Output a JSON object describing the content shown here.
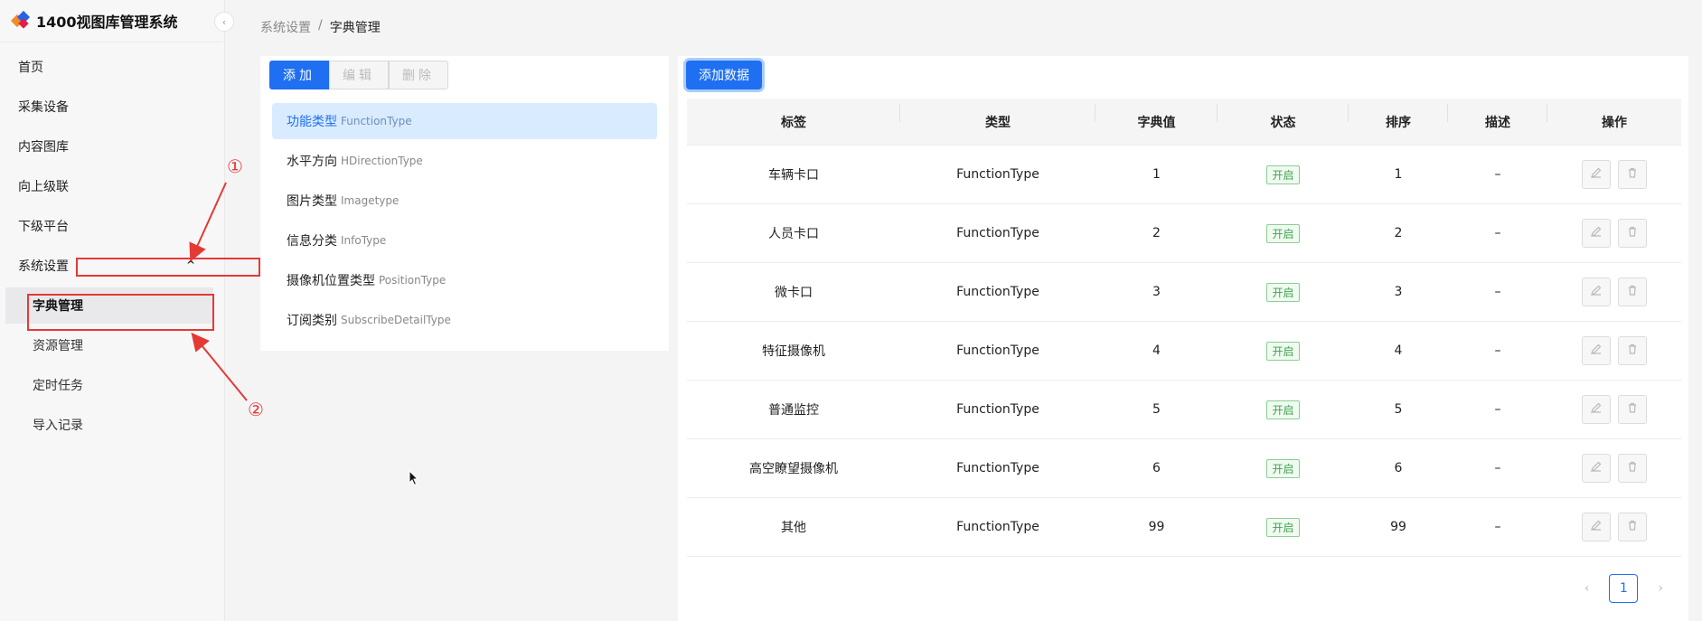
{
  "app": {
    "title": "1400视图库管理系统"
  },
  "sidebar": {
    "items": [
      {
        "label": "首页"
      },
      {
        "label": "采集设备"
      },
      {
        "label": "内容图库"
      },
      {
        "label": "向上级联"
      },
      {
        "label": "下级平台"
      },
      {
        "label": "系统设置"
      }
    ],
    "submenu": [
      {
        "label": "字典管理"
      },
      {
        "label": "资源管理"
      },
      {
        "label": "定时任务"
      },
      {
        "label": "导入记录"
      }
    ]
  },
  "annotations": {
    "marker1": "①",
    "marker2": "②",
    "color": "#e53935"
  },
  "breadcrumb": {
    "parent": "系统设置",
    "separator": "/",
    "current": "字典管理"
  },
  "toolbar": {
    "add": "添加",
    "edit": "编辑",
    "delete": "删除"
  },
  "dict_types": [
    {
      "name": "功能类型",
      "code": "FunctionType"
    },
    {
      "name": "水平方向",
      "code": "HDirectionType"
    },
    {
      "name": "图片类型",
      "code": "Imagetype"
    },
    {
      "name": "信息分类",
      "code": "InfoType"
    },
    {
      "name": "摄像机位置类型",
      "code": "PositionType"
    },
    {
      "name": "订阅类别",
      "code": "SubscribeDetailType"
    }
  ],
  "table": {
    "add_button": "添加数据",
    "headers": [
      "标签",
      "类型",
      "字典值",
      "状态",
      "排序",
      "描述",
      "操作"
    ],
    "rows": [
      {
        "label": "车辆卡口",
        "type": "FunctionType",
        "value": "1",
        "status": "开启",
        "order": "1",
        "desc": "–"
      },
      {
        "label": "人员卡口",
        "type": "FunctionType",
        "value": "2",
        "status": "开启",
        "order": "2",
        "desc": "–"
      },
      {
        "label": "微卡口",
        "type": "FunctionType",
        "value": "3",
        "status": "开启",
        "order": "3",
        "desc": "–"
      },
      {
        "label": "特征摄像机",
        "type": "FunctionType",
        "value": "4",
        "status": "开启",
        "order": "4",
        "desc": "–"
      },
      {
        "label": "普通监控",
        "type": "FunctionType",
        "value": "5",
        "status": "开启",
        "order": "5",
        "desc": "–"
      },
      {
        "label": "高空瞭望摄像机",
        "type": "FunctionType",
        "value": "6",
        "status": "开启",
        "order": "6",
        "desc": "–"
      },
      {
        "label": "其他",
        "type": "FunctionType",
        "value": "99",
        "status": "开启",
        "order": "99",
        "desc": "–"
      }
    ]
  },
  "pagination": {
    "current": "1"
  },
  "colors": {
    "primary": "#1e6ff2",
    "status_green": "#3fa34d"
  }
}
